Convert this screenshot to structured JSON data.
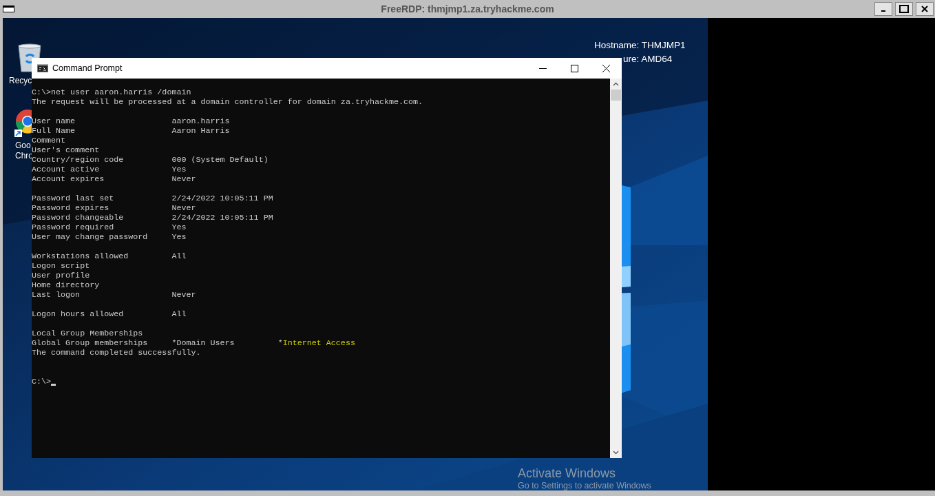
{
  "window": {
    "title": "FreeRDP: thmjmp1.za.tryhackme.com"
  },
  "desktop_icons": [
    {
      "kind": "recycle_bin",
      "label_lines": [
        "Recyc"
      ]
    },
    {
      "kind": "browser",
      "label_lines": [
        "Goo",
        "Chro"
      ]
    }
  ],
  "system_info": [
    "Hostname: THMJMP1",
    "ure: AMD64"
  ],
  "console_window": {
    "title": "Command Prompt",
    "lines": [
      {
        "kind": "text",
        "text": "C:\\>net user aaron.harris /domain"
      },
      {
        "kind": "text",
        "text": "The request will be processed at a domain controller for domain za.tryhackme.com."
      },
      {
        "kind": "blank"
      },
      {
        "kind": "field",
        "label": "User name",
        "value": "aaron.harris"
      },
      {
        "kind": "field",
        "label": "Full Name",
        "value": "Aaron Harris"
      },
      {
        "kind": "field",
        "label": "Comment"
      },
      {
        "kind": "field",
        "label": "User's comment"
      },
      {
        "kind": "field",
        "label": "Country/region code",
        "value": "000 (System Default)"
      },
      {
        "kind": "field",
        "label": "Account active",
        "value": "Yes"
      },
      {
        "kind": "field",
        "label": "Account expires",
        "value": "Never"
      },
      {
        "kind": "blank"
      },
      {
        "kind": "field",
        "label": "Password last set",
        "value": "2/24/2022 10:05:11 PM"
      },
      {
        "kind": "field",
        "label": "Password expires",
        "value": "Never"
      },
      {
        "kind": "field",
        "label": "Password changeable",
        "value": "2/24/2022 10:05:11 PM"
      },
      {
        "kind": "field",
        "label": "Password required",
        "value": "Yes"
      },
      {
        "kind": "field",
        "label": "User may change password",
        "value": "Yes"
      },
      {
        "kind": "blank"
      },
      {
        "kind": "field",
        "label": "Workstations allowed",
        "value": "All"
      },
      {
        "kind": "field",
        "label": "Logon script"
      },
      {
        "kind": "field",
        "label": "User profile"
      },
      {
        "kind": "field",
        "label": "Home directory"
      },
      {
        "kind": "field",
        "label": "Last logon",
        "value": "Never"
      },
      {
        "kind": "blank"
      },
      {
        "kind": "field",
        "label": "Logon hours allowed",
        "value": "All"
      },
      {
        "kind": "blank"
      },
      {
        "kind": "field",
        "label": "Local Group Memberships"
      },
      {
        "kind": "groups",
        "label": "Global Group memberships",
        "groups": [
          {
            "star": "*",
            "name": "Domain Users",
            "color": "#cccccc"
          },
          {
            "star": "*",
            "name": "Internet Access",
            "color": "#d2d200"
          }
        ]
      },
      {
        "kind": "text",
        "text": "The command completed successfully."
      },
      {
        "kind": "blank"
      },
      {
        "kind": "blank"
      },
      {
        "kind": "prompt",
        "text": "C:\\>"
      }
    ]
  },
  "activation_notice": {
    "title": "Activate Windows",
    "subtitle": "Go to Settings to activate Windows"
  }
}
